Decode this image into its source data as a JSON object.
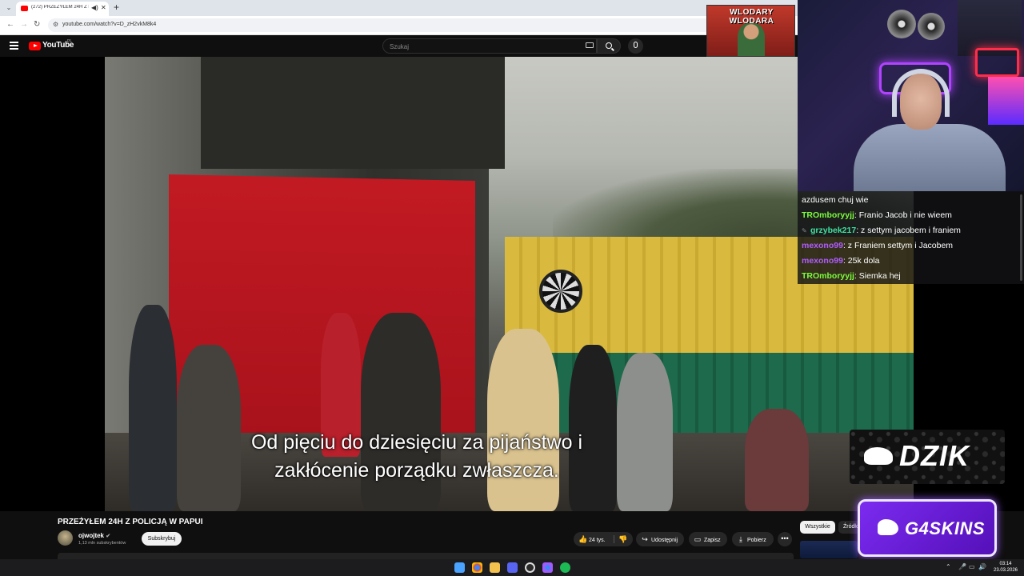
{
  "browser": {
    "tab_title": "(272) PRZEŻYŁEM 24H Z PO",
    "url": "youtube.com/watch?v=D_zH2vkM8k4"
  },
  "youtube": {
    "logo": "YouTube",
    "region": "PL",
    "search_placeholder": "Szukaj"
  },
  "video": {
    "subtitle_line1": "Od pięciu do dziesięciu za pijaństwo i",
    "subtitle_line2": "zakłócenie porządku zwłaszcza.",
    "title": "PRZEŻYŁEM 24H Z POLICJĄ W PAPUI",
    "channel": "ojwojtek",
    "subscribers": "1,13 mln subskrybentów",
    "subscribe_label": "Subskrybuj",
    "likes": "24 tys.",
    "share_label": "Udostępnij",
    "save_label": "Zapisz",
    "download_label": "Pobierz",
    "more_label": "•••"
  },
  "recommendations": {
    "chips": [
      "Wszystkie",
      "Źródło"
    ]
  },
  "overlays": {
    "banner_text_line1": "WLODARY",
    "banner_text_line2": "WLODARA",
    "dzik_text": "DZIK",
    "g4_text": "G4SKINS"
  },
  "chat": [
    {
      "user": "",
      "text": "azdusem chuj wie",
      "color": "#ffffff",
      "badge": ""
    },
    {
      "user": "TROmboryyjj",
      "text": ": Franio Jacob i nie wieem",
      "color": "#7cfc3c",
      "badge": ""
    },
    {
      "user": "grzybek217",
      "text": ": z settym jacobem i franiem",
      "color": "#3fe0a0",
      "badge": "wrench-icon"
    },
    {
      "user": "mexono99",
      "text": ": z Franiem settym i Jacobem",
      "color": "#b05cff",
      "badge": ""
    },
    {
      "user": "mexono99",
      "text": ": 25k dola",
      "color": "#b05cff",
      "badge": ""
    },
    {
      "user": "TROmboryyjj",
      "text": ": Siemka hej",
      "color": "#7cfc3c",
      "badge": ""
    }
  ],
  "taskbar": {
    "time": "03:14",
    "date": "23.03.2026"
  },
  "colors": {
    "yt_red": "#ff0000",
    "g4_purple": "#7b2bf0"
  }
}
